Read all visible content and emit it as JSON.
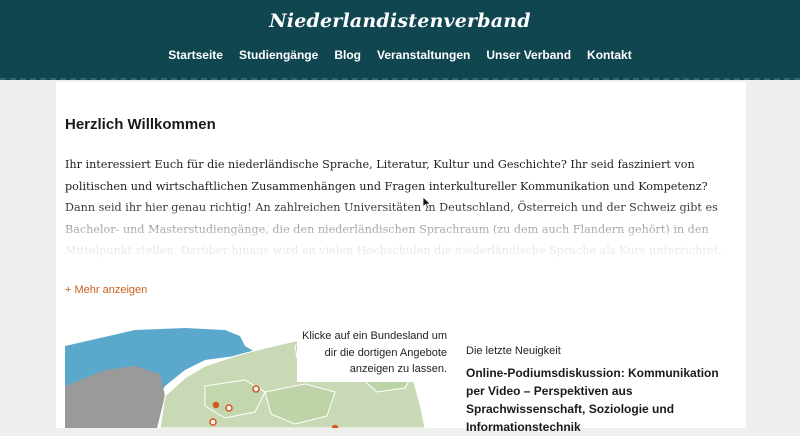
{
  "header": {
    "site_title": "Niederlandistenverband",
    "nav": [
      {
        "label": "Startseite"
      },
      {
        "label": "Studiengänge"
      },
      {
        "label": "Blog"
      },
      {
        "label": "Veranstaltungen"
      },
      {
        "label": "Unser Verband"
      },
      {
        "label": "Kontakt"
      }
    ]
  },
  "main": {
    "heading": "Herzlich Willkommen",
    "intro": "Ihr interessiert Euch für die niederländische Sprache, Literatur, Kultur und Geschichte? Ihr seid fasziniert von politischen und wirtschaftlichen Zusammenhängen und Fragen interkultureller Kommunikation und Kompetenz? Dann seid ihr hier genau richtig! An zahlreichen Universitäten in Deutschland, Österreich und der Schweiz gibt es Bachelor- und Masterstudiengänge, die den niederländischen Sprachraum (zu dem auch Flandern gehört) in den Mittelpunkt stellen. Darüber hinaus wird an vielen Hochschulen die niederländische Sprache als Kurs unterrichtet. Somit besteht die Möglichkeit, im Studium einen interessanten und – mit Blick auf",
    "more_link": "+ Mehr anzeigen",
    "map_hint": "Klicke auf ein Bundesland um dir die dortigen Angebote anzeigen zu lassen.",
    "news_label": "Die letzte Neuigkeit",
    "news_title": "Online-Podiumsdiskussion: Kommunikation per Video – Perspektiven aus Sprachwissenschaft, Soziologie und Informationstechnik"
  },
  "colors": {
    "header_bg": "#0f4650",
    "link_accent": "#c9601d",
    "map_land": "#c9d9b6",
    "map_water": "#4aa3c8",
    "map_neighbor": "#9a9a9a",
    "map_marker": "#d9531e"
  },
  "icons": {
    "cursor": "mouse-pointer-icon",
    "marker": "location-marker-icon"
  }
}
